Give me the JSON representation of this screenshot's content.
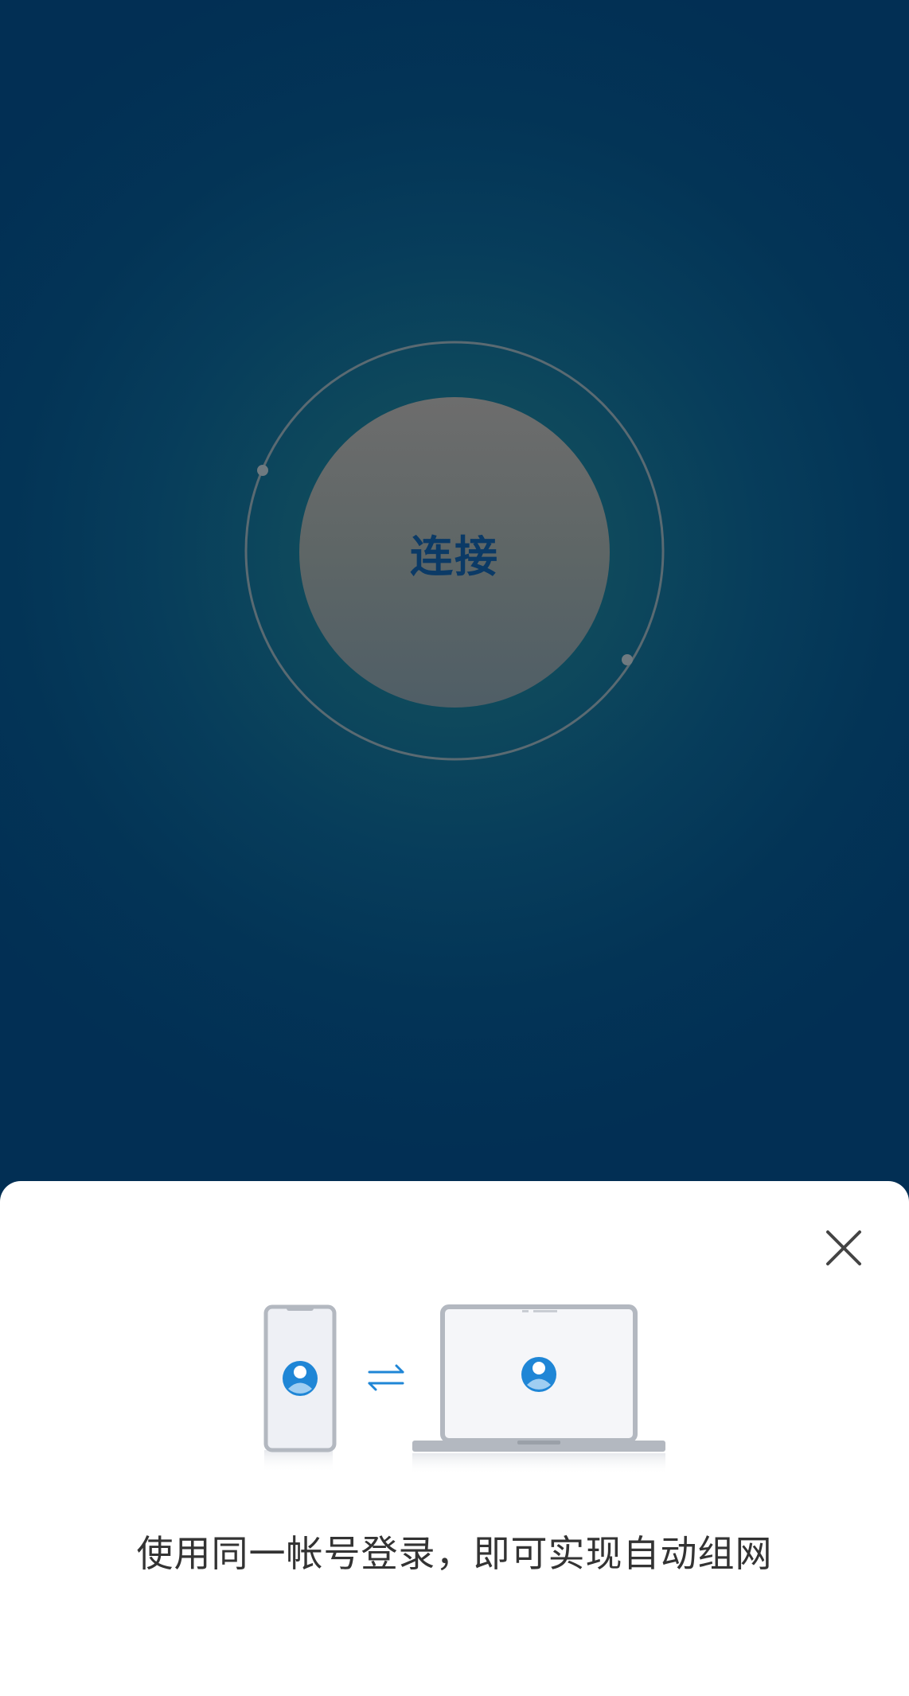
{
  "main": {
    "connect_label": "连接"
  },
  "sheet": {
    "hint": "使用同一帐号登录，即可实现自动组网"
  },
  "icons": {
    "close": "close-icon",
    "phone": "phone-device-icon",
    "laptop": "laptop-device-icon",
    "sync": "swap-arrows-icon",
    "user": "user-avatar-icon"
  },
  "colors": {
    "background": "#022f54",
    "glow": "#13515e",
    "button": "#6d6d6d",
    "label": "#0b3a66",
    "accent": "#1f86d6",
    "sheet": "#ffffff"
  }
}
